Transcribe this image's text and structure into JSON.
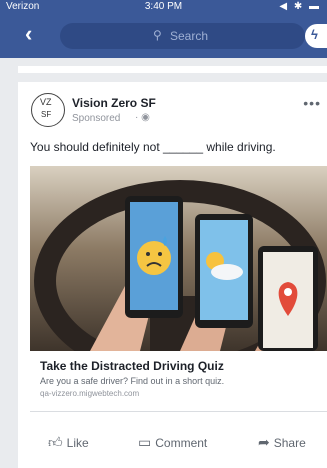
{
  "status": {
    "carrier": "Verizon",
    "time": "3:40 PM",
    "icons": "◀ ✱ ▬"
  },
  "nav": {
    "back": "‹",
    "search_placeholder": "Search",
    "search_icon": "search-icon"
  },
  "post": {
    "page_name": "Vision Zero SF",
    "logo_text_top": "VZ",
    "logo_text_bottom": "SF",
    "sponsored": "Sponsored",
    "text": "You should definitely not ______ while driving.",
    "ad_title": "Take the Distracted Driving Quiz",
    "ad_description": "Are you a safe driver? Find out in a short quiz.",
    "ad_url": "qa-vizzero.migwebtech.com"
  },
  "actions": {
    "like": "Like",
    "comment": "Comment",
    "share": "Share"
  },
  "colors": {
    "facebook_blue": "#3b5998",
    "quiz_pin": "#e24b3a"
  }
}
